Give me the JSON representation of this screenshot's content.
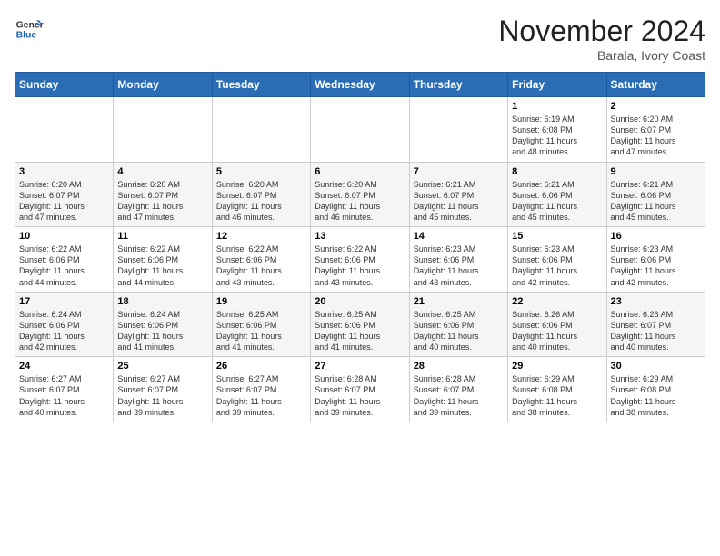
{
  "header": {
    "logo_line1": "General",
    "logo_line2": "Blue",
    "month": "November 2024",
    "location": "Barala, Ivory Coast"
  },
  "days_of_week": [
    "Sunday",
    "Monday",
    "Tuesday",
    "Wednesday",
    "Thursday",
    "Friday",
    "Saturday"
  ],
  "weeks": [
    [
      {
        "day": "",
        "info": ""
      },
      {
        "day": "",
        "info": ""
      },
      {
        "day": "",
        "info": ""
      },
      {
        "day": "",
        "info": ""
      },
      {
        "day": "",
        "info": ""
      },
      {
        "day": "1",
        "info": "Sunrise: 6:19 AM\nSunset: 6:08 PM\nDaylight: 11 hours\nand 48 minutes."
      },
      {
        "day": "2",
        "info": "Sunrise: 6:20 AM\nSunset: 6:07 PM\nDaylight: 11 hours\nand 47 minutes."
      }
    ],
    [
      {
        "day": "3",
        "info": "Sunrise: 6:20 AM\nSunset: 6:07 PM\nDaylight: 11 hours\nand 47 minutes."
      },
      {
        "day": "4",
        "info": "Sunrise: 6:20 AM\nSunset: 6:07 PM\nDaylight: 11 hours\nand 47 minutes."
      },
      {
        "day": "5",
        "info": "Sunrise: 6:20 AM\nSunset: 6:07 PM\nDaylight: 11 hours\nand 46 minutes."
      },
      {
        "day": "6",
        "info": "Sunrise: 6:20 AM\nSunset: 6:07 PM\nDaylight: 11 hours\nand 46 minutes."
      },
      {
        "day": "7",
        "info": "Sunrise: 6:21 AM\nSunset: 6:07 PM\nDaylight: 11 hours\nand 45 minutes."
      },
      {
        "day": "8",
        "info": "Sunrise: 6:21 AM\nSunset: 6:06 PM\nDaylight: 11 hours\nand 45 minutes."
      },
      {
        "day": "9",
        "info": "Sunrise: 6:21 AM\nSunset: 6:06 PM\nDaylight: 11 hours\nand 45 minutes."
      }
    ],
    [
      {
        "day": "10",
        "info": "Sunrise: 6:22 AM\nSunset: 6:06 PM\nDaylight: 11 hours\nand 44 minutes."
      },
      {
        "day": "11",
        "info": "Sunrise: 6:22 AM\nSunset: 6:06 PM\nDaylight: 11 hours\nand 44 minutes."
      },
      {
        "day": "12",
        "info": "Sunrise: 6:22 AM\nSunset: 6:06 PM\nDaylight: 11 hours\nand 43 minutes."
      },
      {
        "day": "13",
        "info": "Sunrise: 6:22 AM\nSunset: 6:06 PM\nDaylight: 11 hours\nand 43 minutes."
      },
      {
        "day": "14",
        "info": "Sunrise: 6:23 AM\nSunset: 6:06 PM\nDaylight: 11 hours\nand 43 minutes."
      },
      {
        "day": "15",
        "info": "Sunrise: 6:23 AM\nSunset: 6:06 PM\nDaylight: 11 hours\nand 42 minutes."
      },
      {
        "day": "16",
        "info": "Sunrise: 6:23 AM\nSunset: 6:06 PM\nDaylight: 11 hours\nand 42 minutes."
      }
    ],
    [
      {
        "day": "17",
        "info": "Sunrise: 6:24 AM\nSunset: 6:06 PM\nDaylight: 11 hours\nand 42 minutes."
      },
      {
        "day": "18",
        "info": "Sunrise: 6:24 AM\nSunset: 6:06 PM\nDaylight: 11 hours\nand 41 minutes."
      },
      {
        "day": "19",
        "info": "Sunrise: 6:25 AM\nSunset: 6:06 PM\nDaylight: 11 hours\nand 41 minutes."
      },
      {
        "day": "20",
        "info": "Sunrise: 6:25 AM\nSunset: 6:06 PM\nDaylight: 11 hours\nand 41 minutes."
      },
      {
        "day": "21",
        "info": "Sunrise: 6:25 AM\nSunset: 6:06 PM\nDaylight: 11 hours\nand 40 minutes."
      },
      {
        "day": "22",
        "info": "Sunrise: 6:26 AM\nSunset: 6:06 PM\nDaylight: 11 hours\nand 40 minutes."
      },
      {
        "day": "23",
        "info": "Sunrise: 6:26 AM\nSunset: 6:07 PM\nDaylight: 11 hours\nand 40 minutes."
      }
    ],
    [
      {
        "day": "24",
        "info": "Sunrise: 6:27 AM\nSunset: 6:07 PM\nDaylight: 11 hours\nand 40 minutes."
      },
      {
        "day": "25",
        "info": "Sunrise: 6:27 AM\nSunset: 6:07 PM\nDaylight: 11 hours\nand 39 minutes."
      },
      {
        "day": "26",
        "info": "Sunrise: 6:27 AM\nSunset: 6:07 PM\nDaylight: 11 hours\nand 39 minutes."
      },
      {
        "day": "27",
        "info": "Sunrise: 6:28 AM\nSunset: 6:07 PM\nDaylight: 11 hours\nand 39 minutes."
      },
      {
        "day": "28",
        "info": "Sunrise: 6:28 AM\nSunset: 6:07 PM\nDaylight: 11 hours\nand 39 minutes."
      },
      {
        "day": "29",
        "info": "Sunrise: 6:29 AM\nSunset: 6:08 PM\nDaylight: 11 hours\nand 38 minutes."
      },
      {
        "day": "30",
        "info": "Sunrise: 6:29 AM\nSunset: 6:08 PM\nDaylight: 11 hours\nand 38 minutes."
      }
    ]
  ]
}
